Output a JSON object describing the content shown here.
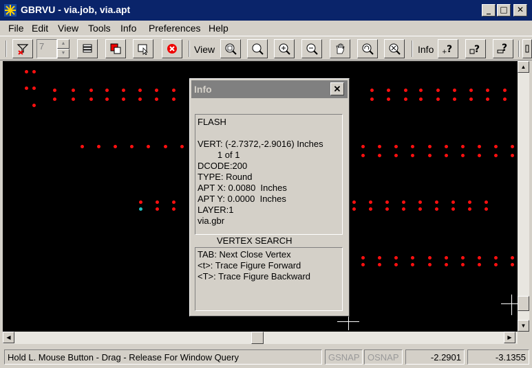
{
  "window": {
    "title": "GBRVU - via.job, via.apt",
    "minimize": "_",
    "maximize": "□",
    "close": "✕"
  },
  "menu": [
    "File",
    "Edit",
    "View",
    "Tools",
    "Info",
    "Preferences",
    "Help"
  ],
  "toolbar": {
    "layer_value": "7",
    "view_label": "View",
    "info_label": "Info",
    "icons": [
      "layer-filter-icon",
      "layers-icon",
      "color-icon",
      "select-icon",
      "stop-icon",
      "zoom-window-icon",
      "zoom-all-icon",
      "zoom-in-icon",
      "zoom-out-icon",
      "pan-icon",
      "zoom-previous-icon",
      "zoom-extents-icon",
      "query-point-icon",
      "query-box-icon",
      "query-measure-icon"
    ]
  },
  "info_dialog": {
    "title": "Info",
    "close": "✕",
    "lines": [
      "FLASH",
      "",
      "VERT: (-2.7372,-2.9016) Inches",
      "        1 of 1",
      "DCODE:200",
      "TYPE: Round",
      "APT X: 0.0080  Inches",
      "APT Y: 0.0000  Inches",
      "LAYER:1",
      "via.gbr"
    ],
    "vertex_search_label": "VERTEX SEARCH",
    "vertex_search_lines": [
      "TAB: Next Close Vertex",
      "<t>: Trace Figure Forward",
      "<T>: Trace Figure Backward"
    ]
  },
  "status": {
    "message": "Hold L. Mouse Button - Drag - Release For Window Query",
    "gsnap": "GSNAP",
    "osnap": "OSNAP",
    "x": "-2.2901",
    "y": "-3.1355"
  },
  "colors": {
    "pad": "#ff1010",
    "highlight_pad": "#20c0c0",
    "canvas": "#000000",
    "titlebar": "#0a246a"
  }
}
